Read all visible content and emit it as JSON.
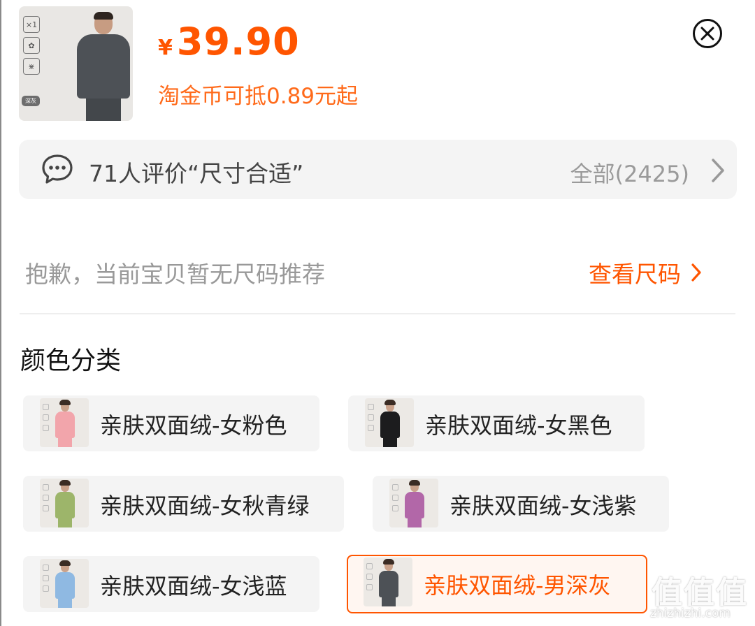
{
  "product": {
    "thumb_tag": "深灰",
    "badge_icons": [
      "times-one-icon",
      "hexagon-flower-icon",
      "hexagon-weave-icon"
    ],
    "price_currency": "¥",
    "price_value": "39.90",
    "coin_deduction": "淘金币可抵0.89元起",
    "price_color": "#ff5500"
  },
  "close_button": {
    "icon": "close-circle-icon"
  },
  "reviews": {
    "summary": "71人评价“尺寸合适”",
    "all_label": "全部(2425)"
  },
  "size": {
    "note": "抱歉，当前宝贝暂无尺码推荐",
    "link_label": "查看尺码"
  },
  "color_section": {
    "title": "颜色分类",
    "options": [
      {
        "label": "亲肤双面绒-女粉色",
        "swatch": "#f2a5ab",
        "selected": false
      },
      {
        "label": "亲肤双面绒-女黑色",
        "swatch": "#1c1c1e",
        "selected": false
      },
      {
        "label": "亲肤双面绒-女秋青绿",
        "swatch": "#9db56a",
        "selected": false
      },
      {
        "label": "亲肤双面绒-女浅紫",
        "swatch": "#b267a8",
        "selected": false
      },
      {
        "label": "亲肤双面绒-女浅蓝",
        "swatch": "#8fb9e2",
        "selected": false
      },
      {
        "label": "亲肤双面绒-男深灰",
        "swatch": "#4d5156",
        "selected": true
      }
    ]
  },
  "watermark": {
    "mark": "值值值",
    "url": "zhizhizhi.com"
  }
}
